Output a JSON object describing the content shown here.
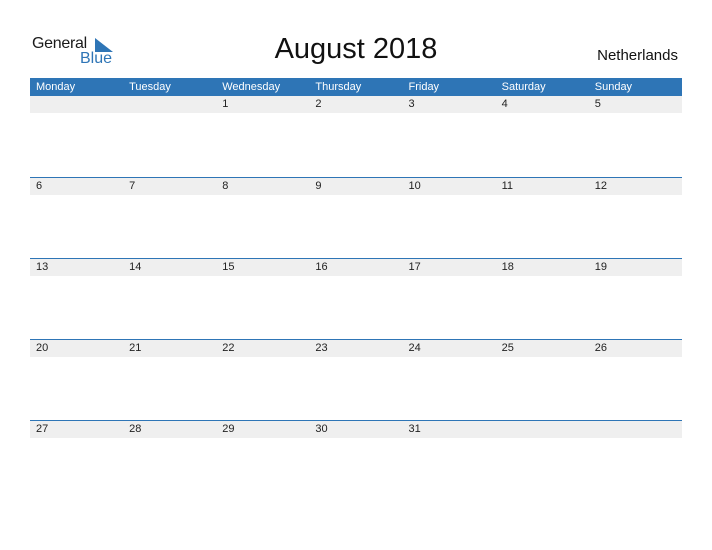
{
  "logo": {
    "line1": "General",
    "line2": "Blue"
  },
  "title": "August 2018",
  "country": "Netherlands",
  "colors": {
    "accent": "#2e75b6",
    "strip": "#efefef"
  },
  "weekdays": [
    "Monday",
    "Tuesday",
    "Wednesday",
    "Thursday",
    "Friday",
    "Saturday",
    "Sunday"
  ],
  "weeks": [
    [
      "",
      "",
      "1",
      "2",
      "3",
      "4",
      "5"
    ],
    [
      "6",
      "7",
      "8",
      "9",
      "10",
      "11",
      "12"
    ],
    [
      "13",
      "14",
      "15",
      "16",
      "17",
      "18",
      "19"
    ],
    [
      "20",
      "21",
      "22",
      "23",
      "24",
      "25",
      "26"
    ],
    [
      "27",
      "28",
      "29",
      "30",
      "31",
      "",
      ""
    ]
  ]
}
